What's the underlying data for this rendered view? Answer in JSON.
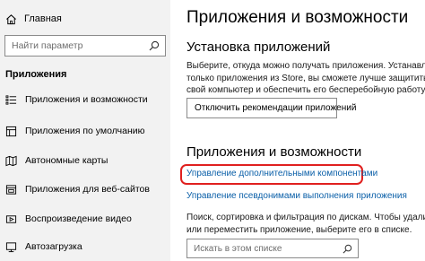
{
  "sidebar": {
    "home_label": "Главная",
    "search_placeholder": "Найти параметр",
    "section_title": "Приложения",
    "items": [
      {
        "label": "Приложения и возможности",
        "icon": "list-icon"
      },
      {
        "label": "Приложения по умолчанию",
        "icon": "default-apps-icon"
      },
      {
        "label": "Автономные карты",
        "icon": "map-icon"
      },
      {
        "label": "Приложения для веб-сайтов",
        "icon": "web-apps-icon"
      },
      {
        "label": "Воспроизведение видео",
        "icon": "video-icon"
      },
      {
        "label": "Автозагрузка",
        "icon": "startup-icon"
      }
    ]
  },
  "main": {
    "title": "Приложения и возможности",
    "install": {
      "heading": "Установка приложений",
      "description_lines": [
        "Выберите, откуда можно получать приложения. Устанавливая",
        "только приложения из Store, вы сможете лучше защитить",
        "свой компьютер и обеспечить его бесперебойную работу."
      ],
      "dropdown_value": "Отключить рекомендации приложений"
    },
    "features": {
      "heading": "Приложения и возможности",
      "link_optional": "Управление дополнительными компонентами",
      "link_aliases": "Управление псевдонимами выполнения приложения",
      "description_lines": [
        "Поиск, сортировка и фильтрация по дискам. Чтобы удалить",
        "или переместить приложение, выберите его в списке."
      ],
      "search_placeholder": "Искать в этом списке"
    }
  },
  "colors": {
    "sidebar_bg": "#f2f2f2",
    "link": "#0a5fa8",
    "highlight": "#e0201f"
  }
}
